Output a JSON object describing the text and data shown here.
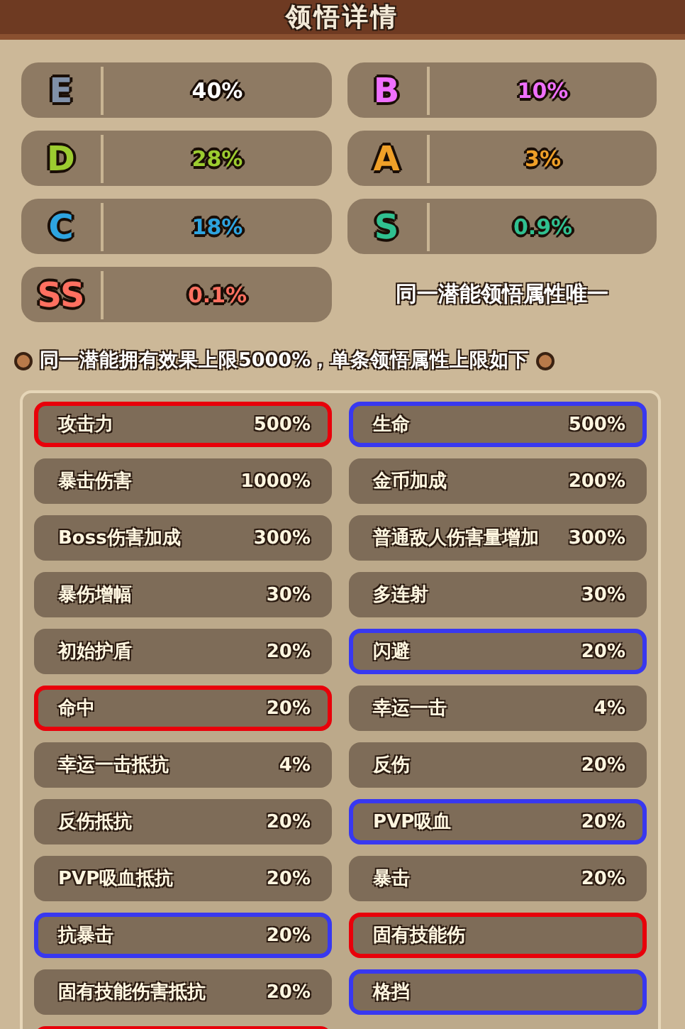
{
  "title": "领悟详情",
  "grades": [
    {
      "grade": "E",
      "chance": "40%",
      "color": "#8090a8"
    },
    {
      "grade": "B",
      "chance": "10%",
      "color": "#f070ff"
    },
    {
      "grade": "D",
      "chance": "28%",
      "color": "#9ccc30"
    },
    {
      "grade": "A",
      "chance": "3%",
      "color": "#f0a028"
    },
    {
      "grade": "C",
      "chance": "18%",
      "color": "#2ea4e0"
    },
    {
      "grade": "S",
      "chance": "0.9%",
      "color": "#30c090"
    },
    {
      "grade": "SS",
      "chance": "0.1%",
      "color": "#ff7060"
    }
  ],
  "grade_note": "同一潜能领悟属性唯一",
  "cap_note": "同一潜能拥有效果上限5000%，单条领悟属性上限如下",
  "attributes": [
    {
      "name": "攻击力",
      "cap": "500%",
      "color": "#e8000a"
    },
    {
      "name": "生命",
      "cap": "500%",
      "color": "#3838f0"
    },
    {
      "name": "暴击伤害",
      "cap": "1000%"
    },
    {
      "name": "金币加成",
      "cap": "200%"
    },
    {
      "name": "Boss伤害加成",
      "cap": "300%"
    },
    {
      "name": "普通敌人伤害量增加",
      "cap": "300%"
    },
    {
      "name": "暴伤增幅",
      "cap": "30%"
    },
    {
      "name": "多连射",
      "cap": "30%"
    },
    {
      "name": "初始护盾",
      "cap": "20%"
    },
    {
      "name": "闪避",
      "cap": "20%",
      "color": "#3838f0"
    },
    {
      "name": "命中",
      "cap": "20%",
      "color": "#e8000a"
    },
    {
      "name": "幸运一击",
      "cap": "4%"
    },
    {
      "name": "幸运一击抵抗",
      "cap": "4%"
    },
    {
      "name": "反伤",
      "cap": "20%"
    },
    {
      "name": "反伤抵抗",
      "cap": "20%"
    },
    {
      "name": "PVP吸血",
      "cap": "20%",
      "color": "#3838f0"
    },
    {
      "name": "PVP吸血抵抗",
      "cap": "20%"
    },
    {
      "name": "暴击",
      "cap": "20%"
    },
    {
      "name": "抗暴击",
      "cap": "20%",
      "color": "#3838f0"
    },
    {
      "name": "固有技能伤",
      "color": "#e8000a"
    },
    {
      "name": "固有技能伤害抵抗",
      "cap": "20%"
    },
    {
      "name": "格挡",
      "color": "#3838f0"
    },
    {
      "color": "#e8000a"
    }
  ]
}
